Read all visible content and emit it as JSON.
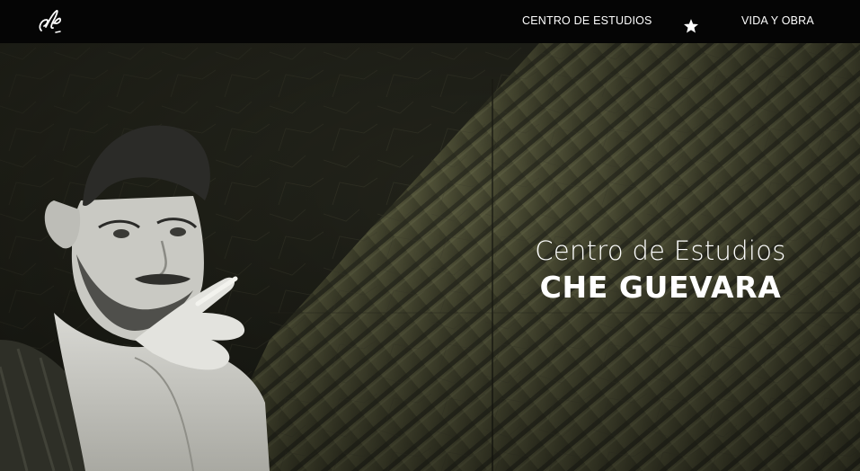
{
  "navbar": {
    "logo_icon": "signature-logo",
    "links": [
      {
        "label": "CENTRO DE ESTUDIOS"
      },
      {
        "label": "VIDA Y OBRA"
      }
    ],
    "separator_icon": "star-icon"
  },
  "hero": {
    "subtitle": "Centro de Estudios",
    "title": "CHE GUEVARA",
    "image": "portrait-photo",
    "background": "textured-olive-wall"
  },
  "colors": {
    "navbar_bg": "#050505",
    "text": "#ffffff",
    "hero_dark": "#1b1d16",
    "hero_olive": "#4a4c32"
  }
}
